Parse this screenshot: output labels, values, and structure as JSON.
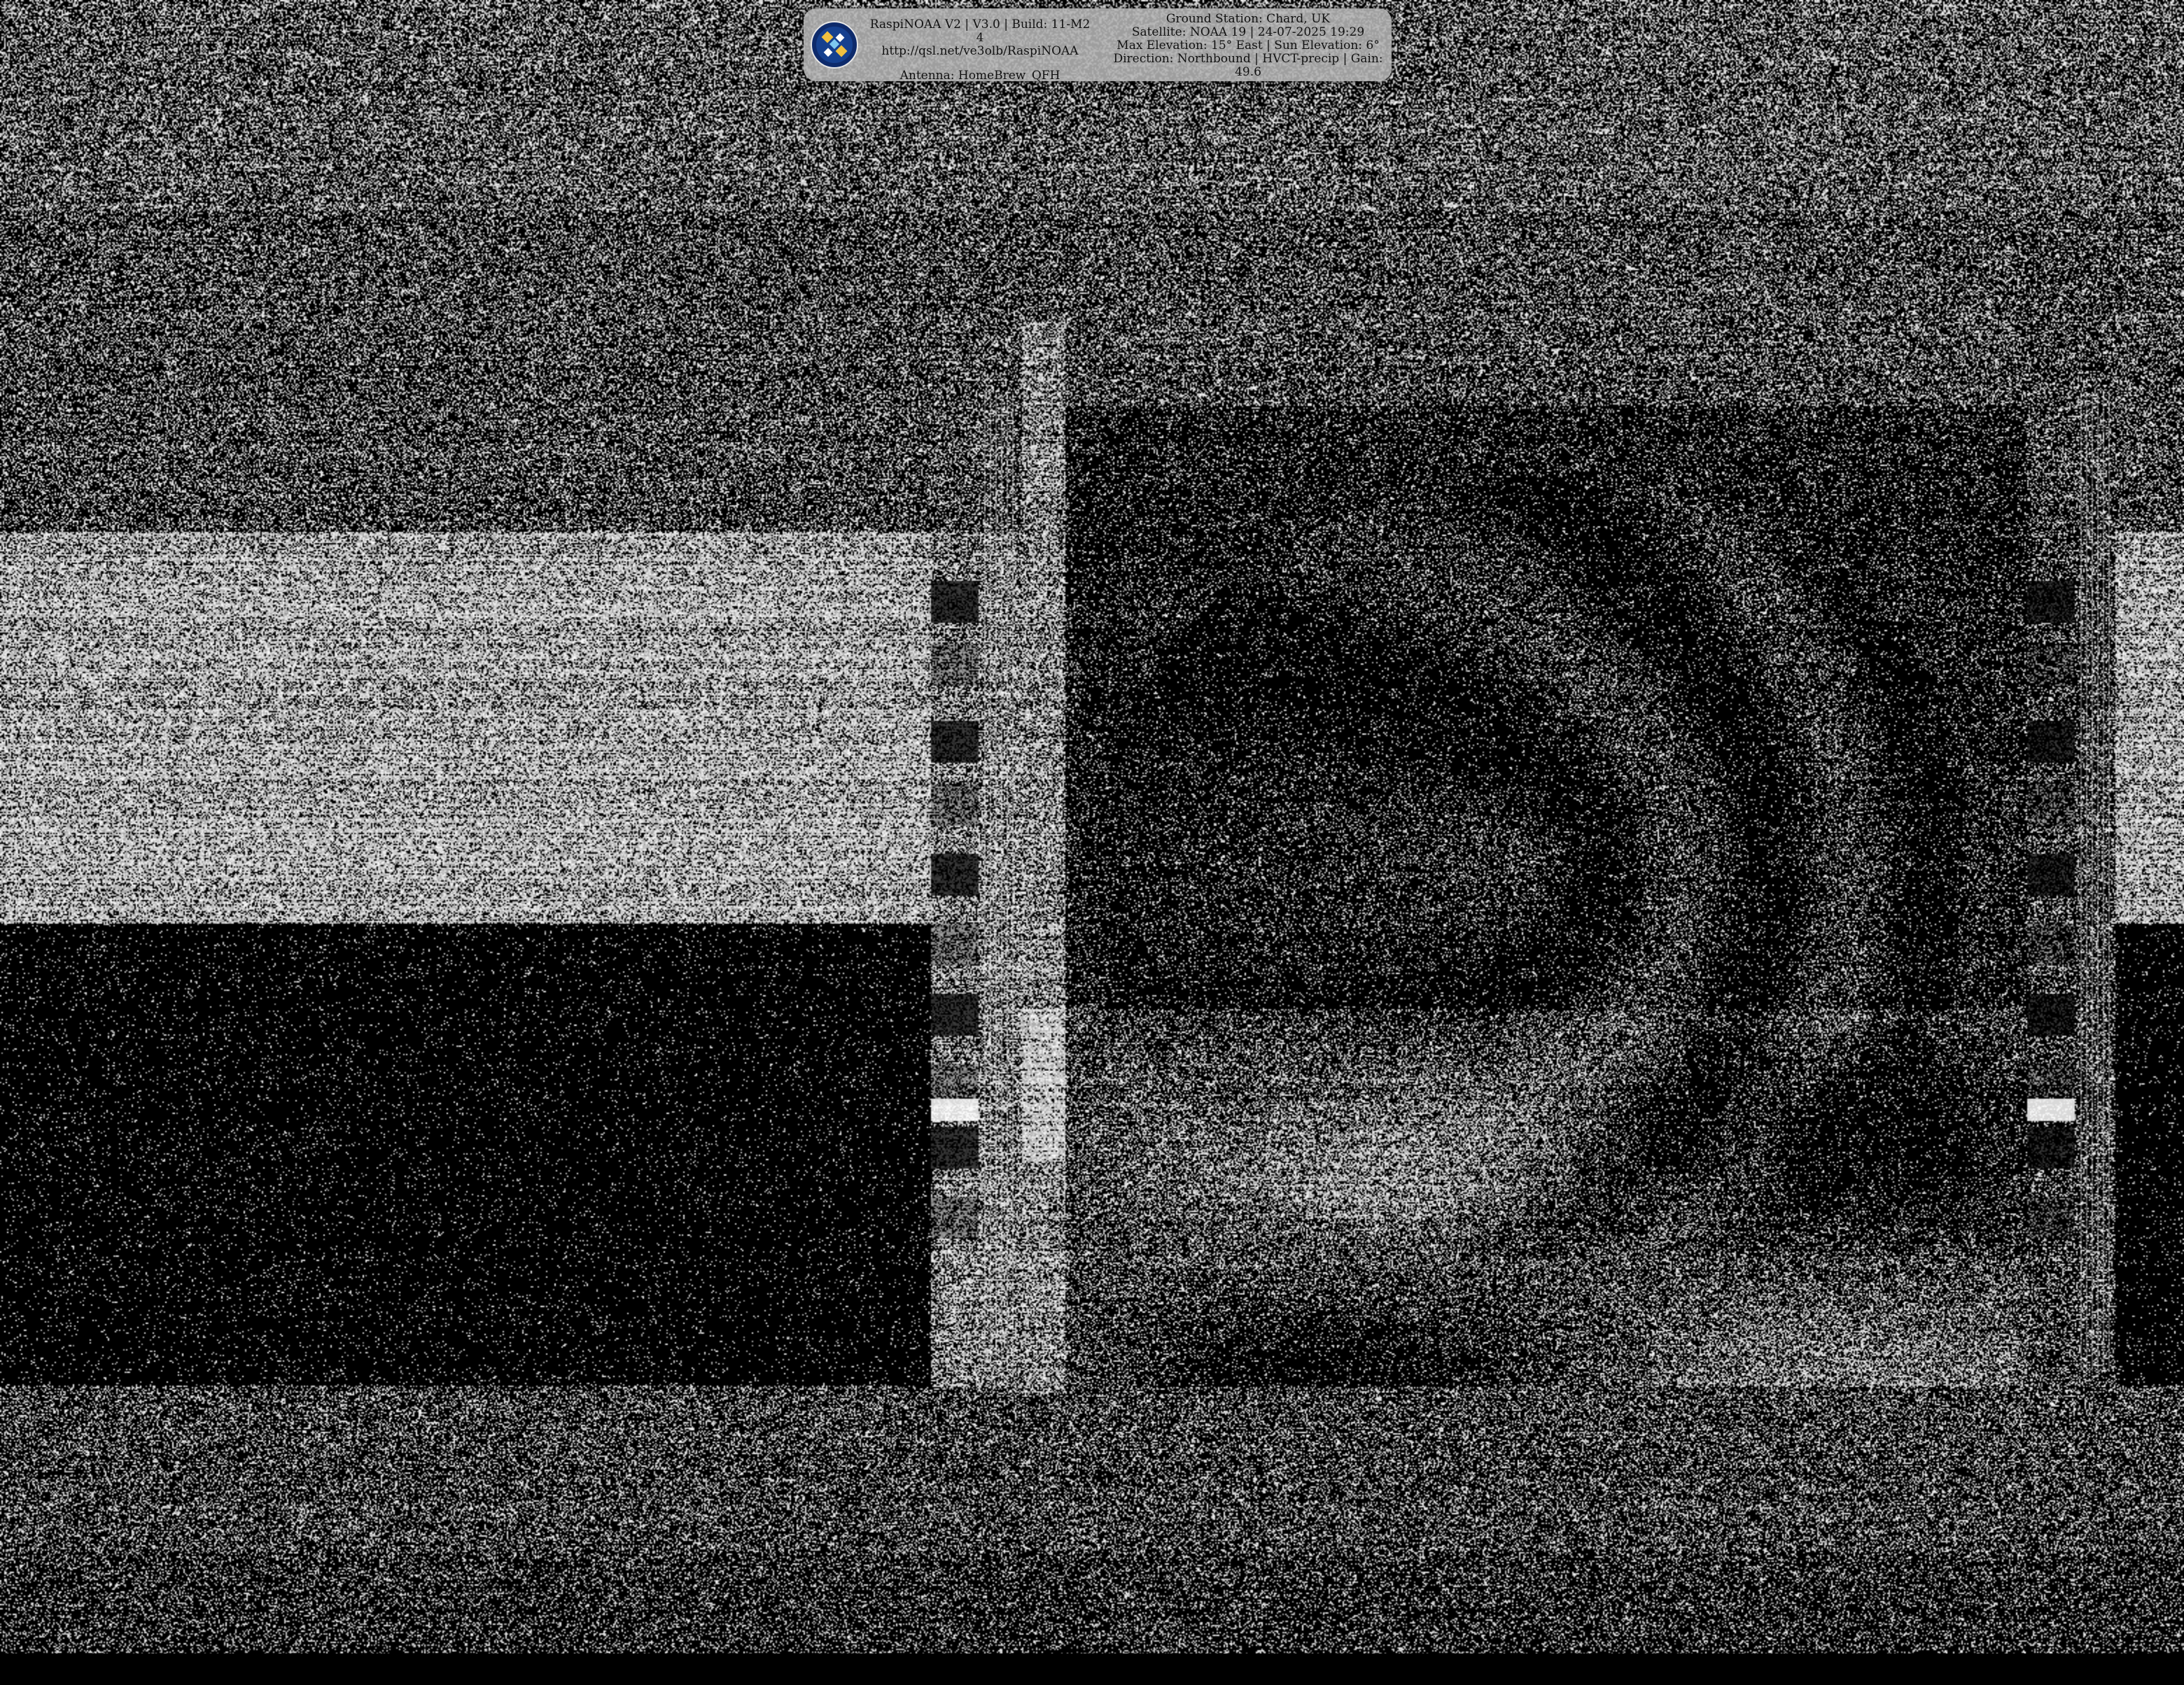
{
  "overlay": {
    "software_line": "RaspiNOAA V2 | V3.0 | Build: 11-M2 4",
    "url_line": "http://qsl.net/ve3olb/RaspiNOAA",
    "antenna_line": "Antenna: HomeBrew_QFH",
    "station_line": "Ground Station: Chard, UK",
    "satellite_line": "Satellite: NOAA 19 | 24-07-2025 19:29",
    "elevation_line": "Max Elevation: 15° East | Sun Elevation: 6°",
    "direction_line": "Direction: Northbound | HVCT-precip | Gain: 49.6",
    "logo_icon": "satellite-logo-icon"
  },
  "image": {
    "content": "NOAA APT weather satellite image with heavy noise",
    "colors": {
      "background": "#000000",
      "overlay_bg": "#b4b4b4",
      "logo_circle": "#0d2a6b",
      "logo_mark": "#f0c040"
    }
  }
}
